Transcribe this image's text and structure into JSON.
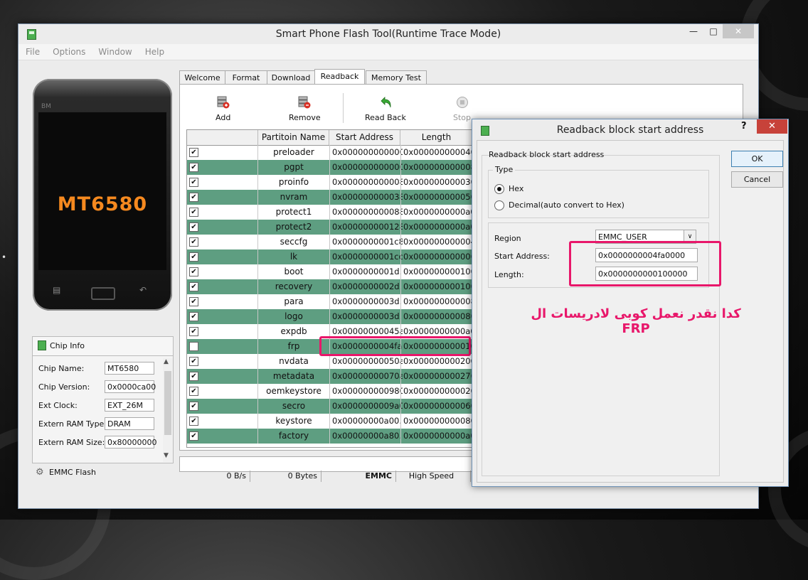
{
  "window": {
    "title": "Smart Phone Flash Tool(Runtime Trace Mode)",
    "menu": [
      "File",
      "Options",
      "Window",
      "Help"
    ]
  },
  "phone": {
    "brand": "BM",
    "chip_label": "MT6580"
  },
  "chip_info": {
    "header": "Chip Info",
    "rows": [
      {
        "label": "Chip Name:",
        "value": "MT6580"
      },
      {
        "label": "Chip Version:",
        "value": "0x0000ca00"
      },
      {
        "label": "Ext Clock:",
        "value": "EXT_26M"
      },
      {
        "label": "Extern RAM Type:",
        "value": "DRAM"
      },
      {
        "label": "Extern RAM Size:",
        "value": "0x80000000"
      }
    ],
    "emmc_header": "EMMC Flash"
  },
  "tabs": [
    "Welcome",
    "Format",
    "Download",
    "Readback",
    "Memory Test"
  ],
  "active_tab": "Readback",
  "toolbar": {
    "add": "Add",
    "remove": "Remove",
    "readback": "Read Back",
    "stop": "Stop"
  },
  "table": {
    "headers": [
      "Partitoin Name",
      "Start Address",
      "Length"
    ],
    "rows": [
      {
        "checked": true,
        "name": "preloader",
        "start": "0x000000000000...",
        "length": "0x000000000040..."
      },
      {
        "checked": true,
        "name": "pgpt",
        "start": "0x000000000000...",
        "length": "0x000000000008..."
      },
      {
        "checked": true,
        "name": "proinfo",
        "start": "0x000000000008...",
        "length": "0x000000000030..."
      },
      {
        "checked": true,
        "name": "nvram",
        "start": "0x000000000038...",
        "length": "0x000000000050..."
      },
      {
        "checked": true,
        "name": "protect1",
        "start": "0x000000000088...",
        "length": "0x0000000000a0..."
      },
      {
        "checked": true,
        "name": "protect2",
        "start": "0x000000000128...",
        "length": "0x0000000000a0..."
      },
      {
        "checked": true,
        "name": "seccfg",
        "start": "0x0000000001c8...",
        "length": "0x000000000004..."
      },
      {
        "checked": true,
        "name": "lk",
        "start": "0x0000000001cc...",
        "length": "0x000000000006..."
      },
      {
        "checked": true,
        "name": "boot",
        "start": "0x0000000001d...",
        "length": "0x000000000100..."
      },
      {
        "checked": true,
        "name": "recovery",
        "start": "0x0000000002d...",
        "length": "0x000000000100..."
      },
      {
        "checked": true,
        "name": "para",
        "start": "0x0000000003d...",
        "length": "0x000000000008..."
      },
      {
        "checked": true,
        "name": "logo",
        "start": "0x0000000003d...",
        "length": "0x000000000080..."
      },
      {
        "checked": true,
        "name": "expdb",
        "start": "0x00000000045a...",
        "length": "0x0000000000a0..."
      },
      {
        "checked": false,
        "name": "frp",
        "start": "0x0000000004fa...",
        "length": "0x000000000010..."
      },
      {
        "checked": true,
        "name": "nvdata",
        "start": "0x00000000050a...",
        "length": "0x000000000200..."
      },
      {
        "checked": true,
        "name": "metadata",
        "start": "0x00000000070a...",
        "length": "0x000000000276..."
      },
      {
        "checked": true,
        "name": "oemkeystore",
        "start": "0x000000000980...",
        "length": "0x000000000020..."
      },
      {
        "checked": true,
        "name": "secro",
        "start": "0x0000000009a0...",
        "length": "0x000000000060..."
      },
      {
        "checked": true,
        "name": "keystore",
        "start": "0x00000000a00...",
        "length": "0x000000000080..."
      },
      {
        "checked": true,
        "name": "factory",
        "start": "0x00000000a80...",
        "length": "0x0000000000a0..."
      }
    ]
  },
  "status": {
    "speed": "0 B/s",
    "bytes": "0 Bytes",
    "storage": "EMMC",
    "mode": "High Speed"
  },
  "dialog": {
    "title": "Readback block start address",
    "help": "?",
    "group_label": "Readback block start address",
    "type_label": "Type",
    "option_hex": "Hex",
    "option_decimal": "Decimal(auto convert to Hex)",
    "region_label": "Region",
    "region_value": "EMMC_USER",
    "start_label": "Start Address:",
    "start_value": "0x0000000004fa0000",
    "length_label": "Length:",
    "length_value": "0x0000000000100000",
    "ok": "OK",
    "cancel": "Cancel"
  },
  "annotation": {
    "text": "كدا نقدر نعمل كوبى لادريسات ال FRP",
    "color": "#e8176a"
  },
  "colors": {
    "row_alt": "#5e9e81",
    "highlight": "#e8176a",
    "chip_text": "#f5891f"
  }
}
